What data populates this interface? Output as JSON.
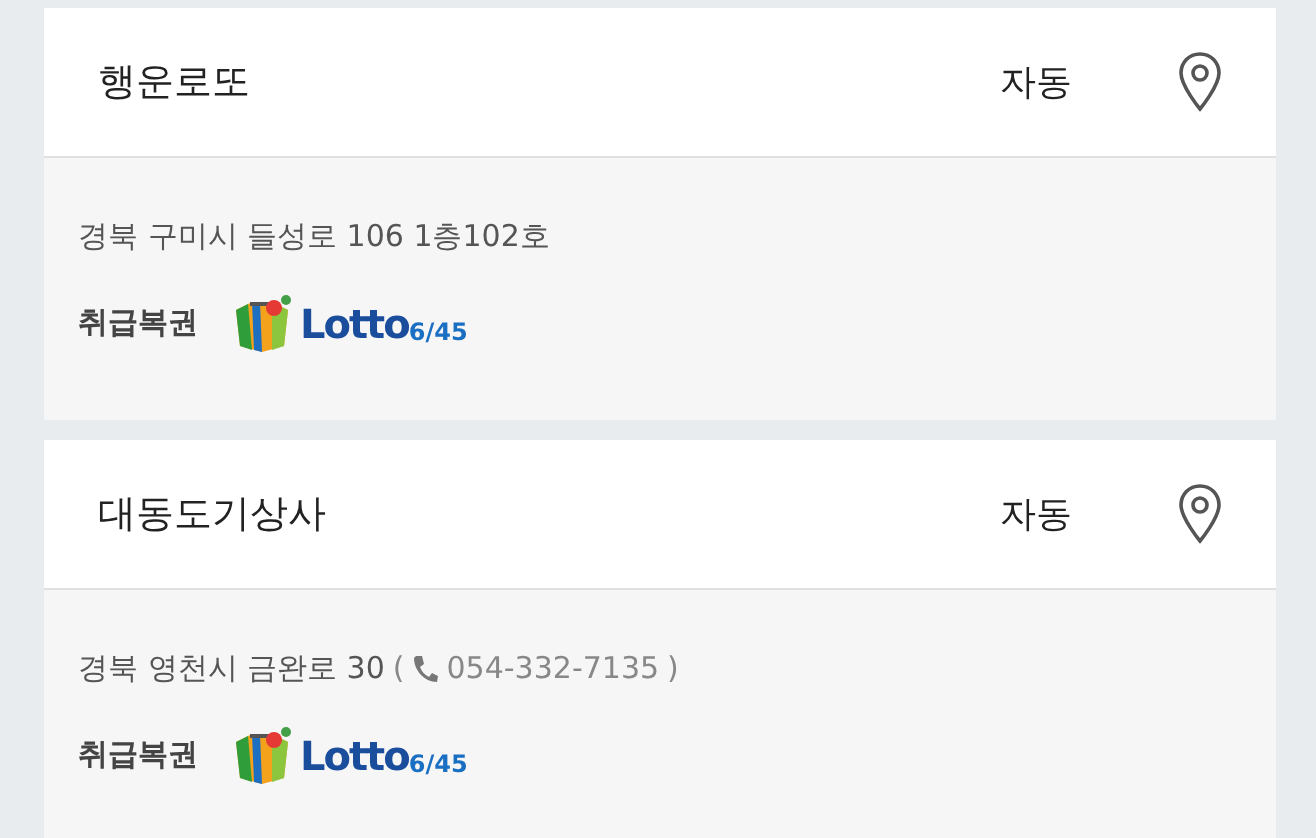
{
  "stores": [
    {
      "name": "행운로또",
      "type": "자동",
      "address": "경북 구미시 들성로 106 1층102호",
      "label": "취급복권",
      "logo": {
        "brand": "Lotto",
        "game": "6/45"
      }
    },
    {
      "name": "대동도기상사",
      "type": "자동",
      "address": "경북 영천시 금완로 30",
      "phone": {
        "open": "(",
        "number": "054-332-7135",
        "close": ")"
      },
      "label": "취급복권",
      "logo": {
        "brand": "Lotto",
        "game": "6/45"
      }
    }
  ]
}
